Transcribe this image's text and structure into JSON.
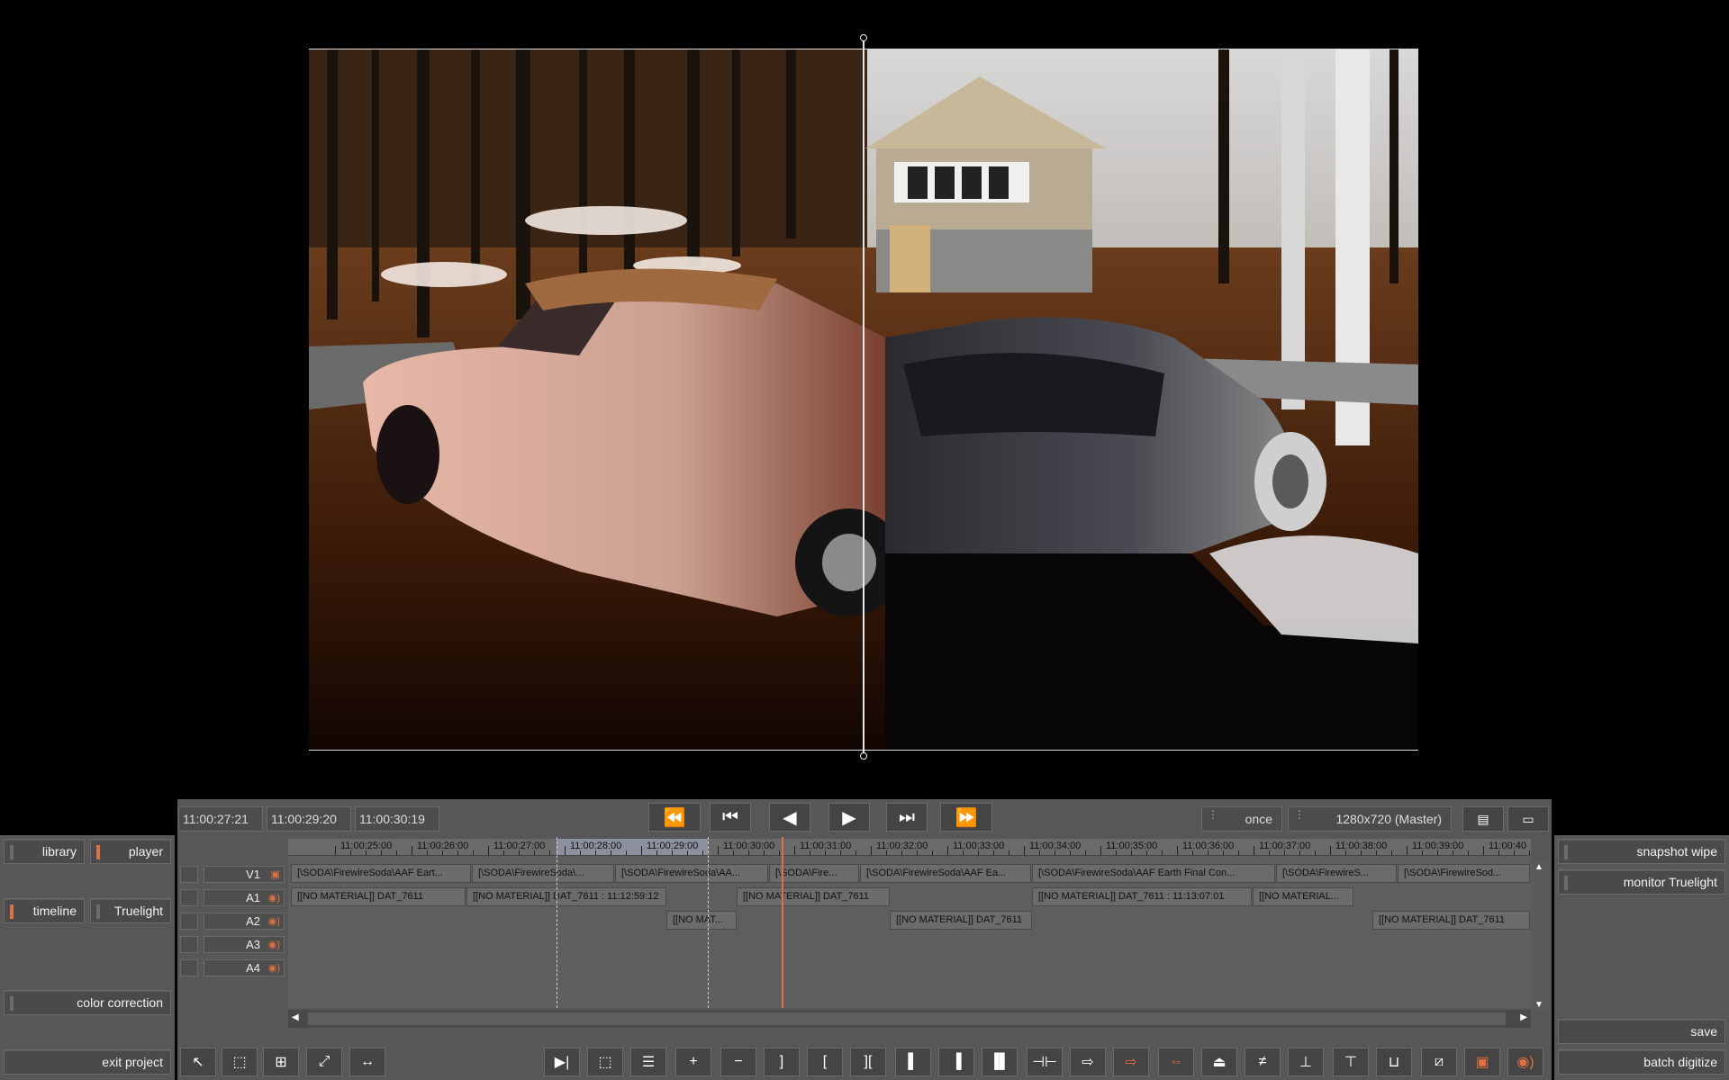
{
  "left_panel": {
    "library": "library",
    "player": "player",
    "timeline": "timeline",
    "truelight": "Truelight",
    "color_correction": "color correction",
    "exit_project": "exit project"
  },
  "right_panel": {
    "snapshot_wipe": "snapshot wipe",
    "monitor_truelight": "monitor Truelight",
    "save": "save",
    "batch_digitize": "batch digitize"
  },
  "transport": {
    "tc_in": "11:00:27:21",
    "tc_current": "11:00:29:20",
    "tc_out": "11:00:30:19",
    "loop_mode": "once",
    "resolution": "1280x720 (Master)"
  },
  "ruler": {
    "labels": [
      "11:00:25:00",
      "11:00:26:00",
      "11:00:27:00",
      "11:00:28:00",
      "11:00:29:00",
      "11:00:30:00",
      "11:00:31:00",
      "11:00:32:00",
      "11:00:33:00",
      "11:00:34:00",
      "11:00:35:00",
      "11:00:36:00",
      "11:00:37:00",
      "11:00:38:00",
      "11:00:39:00",
      "11:00:40"
    ]
  },
  "tracks": [
    {
      "name": "V1",
      "type": "video"
    },
    {
      "name": "A1",
      "type": "audio"
    },
    {
      "name": "A2",
      "type": "audio"
    },
    {
      "name": "A3",
      "type": "audio"
    },
    {
      "name": "A4",
      "type": "audio"
    }
  ],
  "clips": {
    "v1": [
      "[\\SODA\\FirewireSoda\\AAF Eart...",
      "[\\SODA\\FirewireSoda\\...",
      "[\\SODA\\FirewireSoda\\AA...",
      "[\\SODA\\Fire...",
      "[\\SODA\\FirewireSoda\\AAF Ea...",
      "[\\SODA\\FirewireSoda\\AAF Earth Final Con...",
      "[\\SODA\\FirewireS...",
      "[\\SODA\\FirewireSod..."
    ],
    "a1": [
      "[[NO MATERIAL]] DAT_7611",
      "[[NO MATERIAL]] DAT_7611 : 11:12:59:12",
      "[[NO MATERIAL]] DAT_7611",
      "[[NO MATERIAL]] DAT_7611 : 11:13:07:01",
      "[[NO MATERIAL..."
    ],
    "a2": [
      "[[NO MAT...",
      "[[NO MATERIAL]] DAT_7611",
      "[[NO MATERIAL]] DAT_7611"
    ]
  },
  "colors": {
    "accent": "#e07040",
    "panel": "#575757",
    "background": "#000000"
  },
  "icons": [
    "rewind-icon",
    "go-to-start-icon",
    "play-reverse-icon",
    "play-icon",
    "go-to-end-icon",
    "fast-forward-icon"
  ]
}
